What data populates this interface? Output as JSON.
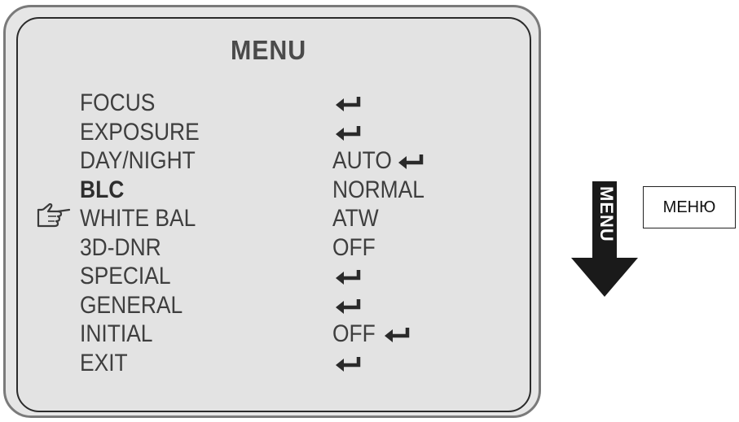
{
  "menu": {
    "title": "MENU",
    "selected_index": 3,
    "items": [
      {
        "label": "FOCUS",
        "value": "",
        "submenu": true
      },
      {
        "label": "EXPOSURE",
        "value": "",
        "submenu": true
      },
      {
        "label": "DAY/NIGHT",
        "value": "AUTO",
        "submenu": true
      },
      {
        "label": "BLC",
        "value": "NORMAL",
        "submenu": false
      },
      {
        "label": "WHITE BAL",
        "value": "ATW",
        "submenu": false
      },
      {
        "label": "3D-DNR",
        "value": "OFF",
        "submenu": false
      },
      {
        "label": "SPECIAL",
        "value": "",
        "submenu": true
      },
      {
        "label": "GENERAL",
        "value": "",
        "submenu": true
      },
      {
        "label": "INITIAL",
        "value": "OFF",
        "submenu": true
      },
      {
        "label": "EXIT",
        "value": "",
        "submenu": true
      }
    ]
  },
  "menu_button": {
    "arrow_text": "MENU",
    "caption": "МЕНЮ"
  },
  "icons": {
    "enter": "enter-return-icon",
    "cursor": "pointing-hand-cursor-icon",
    "arrow": "down-arrow-icon"
  },
  "colors": {
    "screen_bg": "#e3e3e3",
    "text": "#3e3e3e",
    "arrow": "#1a1a1a"
  }
}
